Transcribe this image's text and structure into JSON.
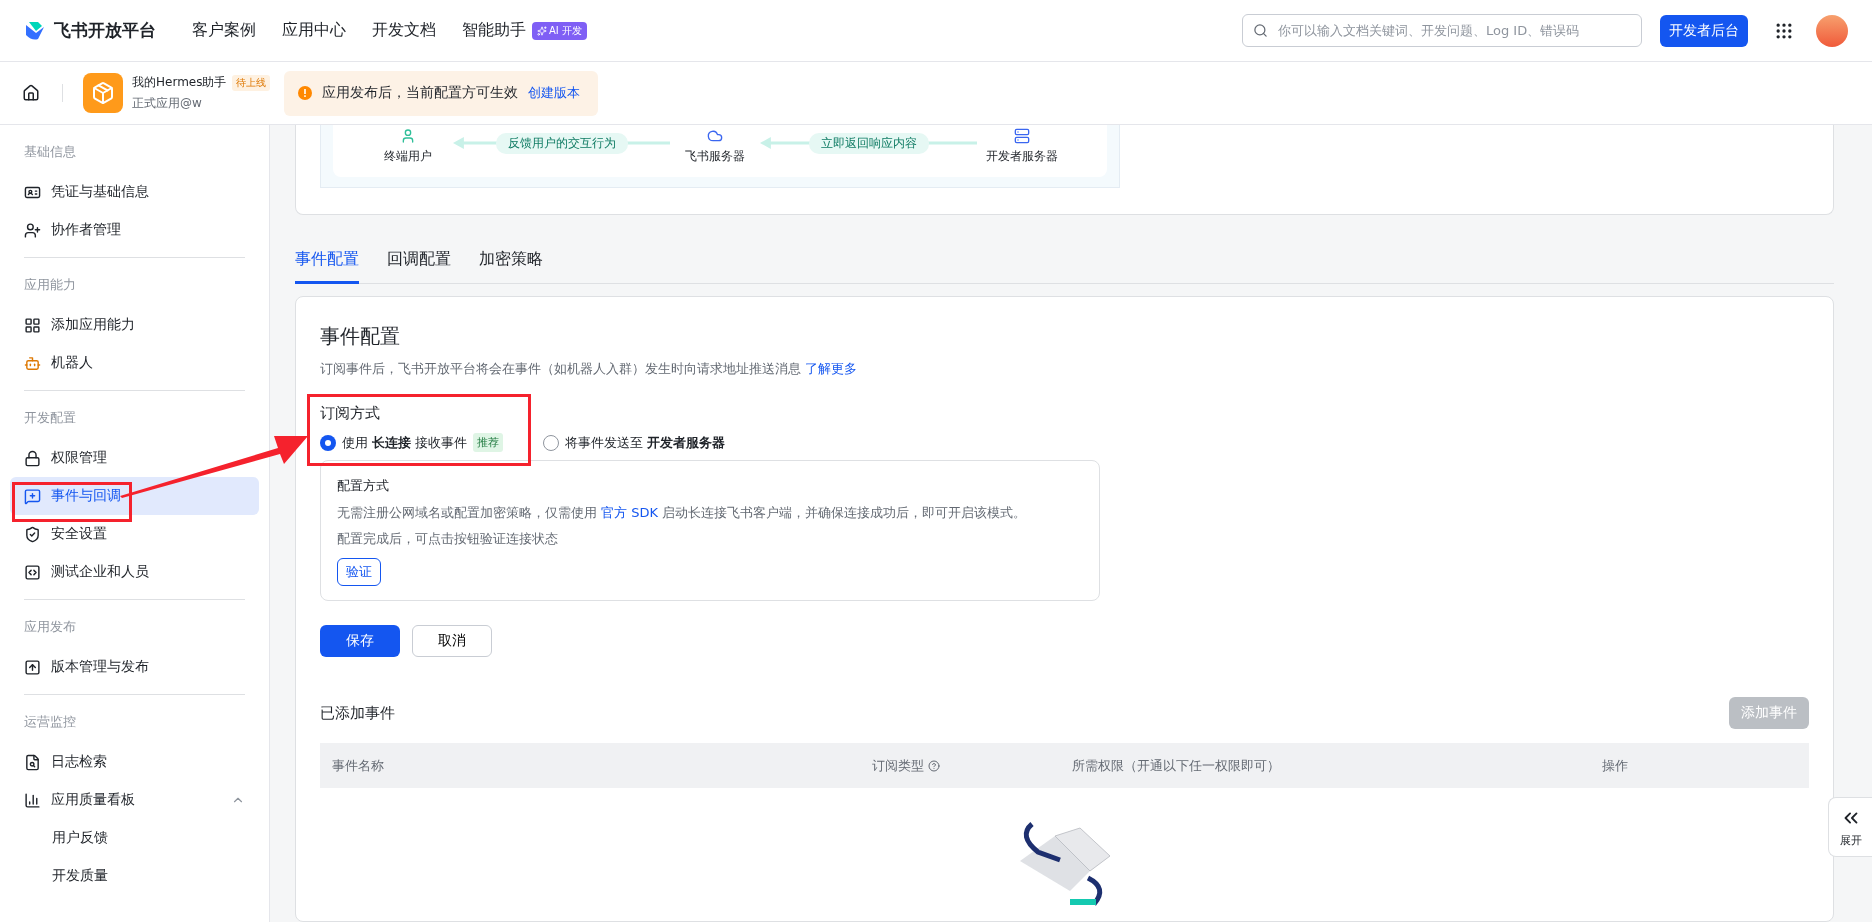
{
  "header": {
    "brand": "飞书开放平台",
    "nav": [
      {
        "label": "客户案例"
      },
      {
        "label": "应用中心"
      },
      {
        "label": "开发文档"
      },
      {
        "label": "智能助手",
        "tag": "AI 开发"
      }
    ],
    "search": {
      "placeholder": "你可以输入文档关键词、开发问题、Log ID、错误码"
    },
    "console_button": "开发者后台"
  },
  "app_bar": {
    "app_name": "我的Hermes助手",
    "status_badge": "待上线",
    "app_type": "正式应用@w",
    "notice": {
      "text": "应用发布后，当前配置方可生效",
      "link": "创建版本"
    }
  },
  "sidebar": {
    "groups": [
      {
        "title": "基础信息",
        "items": [
          {
            "label": "凭证与基础信息",
            "kind": "id",
            "selected": false
          },
          {
            "label": "协作者管理",
            "kind": "user",
            "selected": false
          }
        ]
      },
      {
        "title": "应用能力",
        "items": [
          {
            "label": "添加应用能力",
            "kind": "apps",
            "selected": false
          },
          {
            "label": "机器人",
            "kind": "bot",
            "selected": false
          }
        ]
      },
      {
        "title": "开发配置",
        "items": [
          {
            "label": "权限管理",
            "kind": "lock",
            "selected": false
          },
          {
            "label": "事件与回调",
            "kind": "event",
            "selected": true
          },
          {
            "label": "安全设置",
            "kind": "shield",
            "selected": false
          },
          {
            "label": "测试企业和人员",
            "kind": "code",
            "selected": false
          }
        ]
      },
      {
        "title": "应用发布",
        "items": [
          {
            "label": "版本管理与发布",
            "kind": "upload",
            "selected": false
          }
        ]
      },
      {
        "title": "运营监控",
        "items": [
          {
            "label": "日志检索",
            "kind": "log",
            "selected": false
          },
          {
            "label": "应用质量看板",
            "kind": "chart",
            "selected": false,
            "expanded": true,
            "children": [
              {
                "label": "用户反馈",
                "selected": false
              },
              {
                "label": "开发质量",
                "selected": false
              }
            ]
          }
        ]
      }
    ]
  },
  "diagram": {
    "nodes": [
      {
        "label": "终端用户",
        "kind": "user"
      },
      {
        "label": "飞书服务器",
        "kind": "platform"
      },
      {
        "label": "开发者服务器",
        "kind": "server"
      }
    ],
    "links": [
      {
        "label": "反馈用户的交互行为"
      },
      {
        "label": "立即返回响应内容"
      }
    ]
  },
  "tabs": [
    {
      "label": "事件配置",
      "selected": true
    },
    {
      "label": "回调配置",
      "selected": false
    },
    {
      "label": "加密策略",
      "selected": false
    }
  ],
  "event_config": {
    "title": "事件配置",
    "description": "订阅事件后，飞书开放平台将会在事件（如机器人入群）发生时向请求地址推送消息",
    "learn_more": "了解更多",
    "subscription": {
      "title": "订阅方式",
      "options": [
        {
          "label": "使用 **长连接** 接收事件",
          "tag": "推荐",
          "selected": true
        },
        {
          "label": "将事件发送至 **开发者服务器**",
          "selected": false
        }
      ]
    },
    "config_box": {
      "title": "配置方式",
      "text_before": "无需注册公网域名或配置加密策略，仅需使用 ",
      "link": "官方 SDK",
      "text_after": " 启动长连接飞书客户端，并确保连接成功后，即可开启该模式。",
      "note": "配置完成后，可点击按钮验证连接状态",
      "verify_button": "验证"
    },
    "buttons": {
      "save": "保存",
      "cancel": "取消"
    }
  },
  "events": {
    "title": "已添加事件",
    "add_button": {
      "label": "添加事件",
      "disabled": true
    },
    "columns": [
      {
        "label": "事件名称"
      },
      {
        "label": "订阅类型",
        "help": true
      },
      {
        "label": "所需权限（开通以下任一权限即可）"
      },
      {
        "label": "操作"
      }
    ]
  },
  "expand_button": "展开"
}
